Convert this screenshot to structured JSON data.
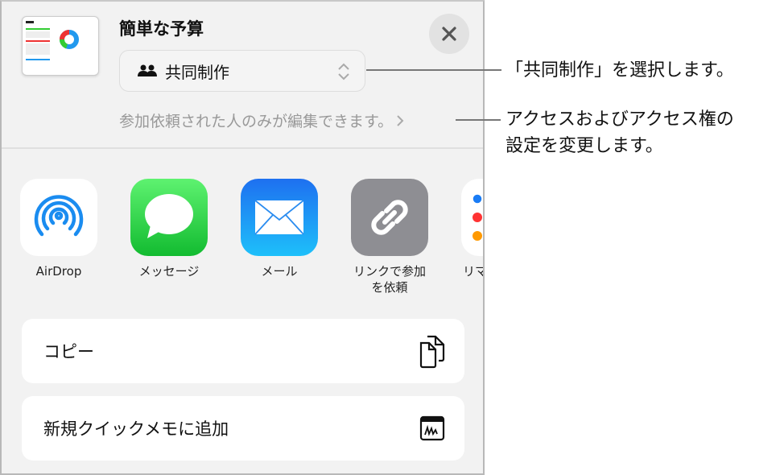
{
  "sheet": {
    "document_title": "簡単な予算",
    "collaboration_mode": "共同制作",
    "permission_summary": "参加依頼された人のみが編集できます。",
    "apps": [
      {
        "label": "AirDrop",
        "icon": "airdrop-icon",
        "color": "#1a8cf0"
      },
      {
        "label": "メッセージ",
        "icon": "messages-icon",
        "color": "#2ecc4a"
      },
      {
        "label": "メール",
        "icon": "mail-icon",
        "color": "#1e88f5"
      },
      {
        "label": "リンクで参加\nを依頼",
        "icon": "link-icon",
        "color": "#8e8e93"
      },
      {
        "label": "リマ",
        "icon": "reminders-icon",
        "color": "#ffffff"
      }
    ],
    "actions": [
      {
        "label": "コピー",
        "icon": "copy-icon"
      },
      {
        "label": "新規クイックメモに追加",
        "icon": "quick-note-icon"
      }
    ]
  },
  "annotations": {
    "collaboration": "「共同制作」を選択します。",
    "access_line1": "アクセスおよびアクセス権の",
    "access_line2": "設定を変更します。"
  }
}
